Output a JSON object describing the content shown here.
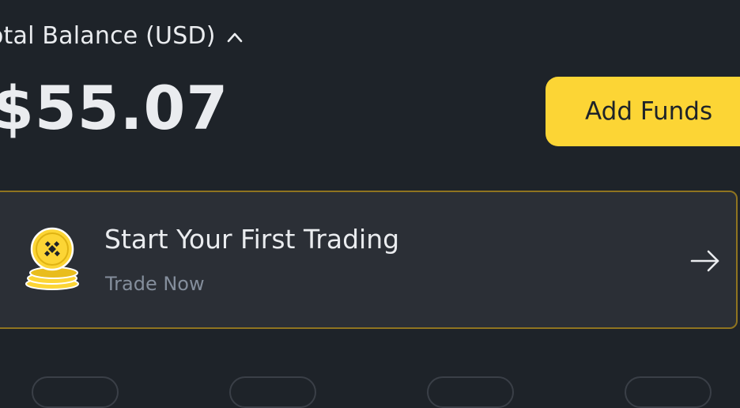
{
  "balance": {
    "label": "otal Balance (USD)",
    "amount": "$55.07"
  },
  "actions": {
    "add_funds_label": "Add Funds"
  },
  "promo": {
    "title": "Start Your First Trading",
    "subtitle": "Trade Now"
  },
  "icons": {
    "balance_toggle": "chevron-up-icon",
    "promo_coin": "coin-stack-icon",
    "promo_arrow": "arrow-right-icon"
  },
  "colors": {
    "background": "#1e2329",
    "accent": "#fcd535",
    "card": "#2b2f36",
    "card_border": "#8f7420",
    "muted_text": "#848e9c"
  }
}
